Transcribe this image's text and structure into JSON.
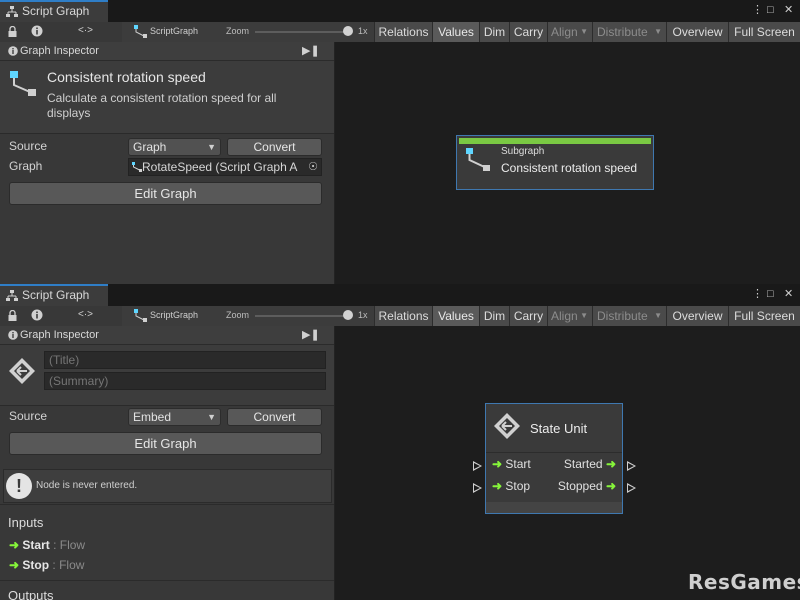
{
  "top_window": {
    "tab_title": "Script Graph",
    "toolbar": {
      "breadcrumb": "ScriptGraph",
      "zoom_label": "Zoom",
      "zoom_value": "1x",
      "zoom_level": 1.0,
      "buttons": [
        "Relations",
        "Values",
        "Dim",
        "Carry",
        "Align",
        "Distribute",
        "Overview",
        "Full Screen"
      ]
    },
    "inspector": {
      "header": "Graph Inspector",
      "title": "Consistent rotation speed",
      "summary": "Calculate a consistent rotation speed for all displays",
      "source_label": "Source",
      "source_value": "Graph",
      "convert_label": "Convert",
      "graph_label": "Graph",
      "graph_value": "RotateSpeed (Script Graph A",
      "edit_label": "Edit Graph"
    },
    "canvas": {
      "node_kind": "Subgraph",
      "node_title": "Consistent rotation speed",
      "header_color": "#7ac943"
    }
  },
  "bottom_window": {
    "tab_title": "Script Graph",
    "toolbar": {
      "breadcrumb": "ScriptGraph",
      "zoom_label": "Zoom",
      "zoom_value": "1x",
      "zoom_level": 1.0,
      "buttons": [
        "Relations",
        "Values",
        "Dim",
        "Carry",
        "Align",
        "Distribute",
        "Overview",
        "Full Screen"
      ]
    },
    "inspector": {
      "header": "Graph Inspector",
      "title_placeholder": "(Title)",
      "summary_placeholder": "(Summary)",
      "source_label": "Source",
      "source_value": "Embed",
      "convert_label": "Convert",
      "edit_label": "Edit Graph",
      "warning": "Node is never entered.",
      "inputs_header": "Inputs",
      "inputs": [
        {
          "name": "Start",
          "type": ": Flow"
        },
        {
          "name": "Stop",
          "type": ": Flow"
        }
      ],
      "outputs_header": "Outputs"
    },
    "canvas": {
      "node_title": "State Unit",
      "ports_in": [
        "Start",
        "Stop"
      ],
      "ports_out": [
        "Started",
        "Stopped"
      ]
    }
  },
  "watermark": "ResGames",
  "colors": {
    "accent": "#2f7ec7",
    "flow_arrow": "#86f53a",
    "node_border": "#3f78b0",
    "canvas_bg": "#1d1d1d"
  }
}
